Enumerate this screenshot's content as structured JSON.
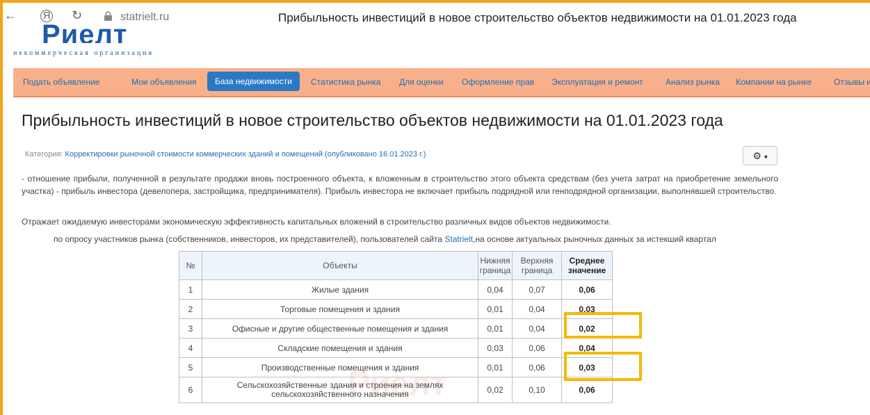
{
  "browser": {
    "url": "statrielt.ru",
    "tab_title": "Прибыльность инвестиций в новое строительство объектов недвижимости на 01.01.2023 года",
    "back_glyph": "←",
    "refresh_glyph": "↻",
    "ya_glyph": "Я"
  },
  "logo": {
    "name": "Риелт",
    "tagline": "некоммерческая организация"
  },
  "nav": {
    "items": [
      "Подать объявление",
      "Мои объявления",
      "База недвижимости",
      "Статистика рынка",
      "Для оценки",
      "Оформление прав",
      "Эксплуатация и ремонт",
      "Анализ рынка",
      "Компании на рынке",
      "Отзывы и"
    ],
    "active_index": 2
  },
  "page": {
    "title": "Прибыльность инвестиций в новое строительство объектов недвижимости на 01.01.2023 года",
    "category_label": "Категория:",
    "category_link": "Корректировки рыночной стоимости коммерческих зданий и помещений (опубликовано 16.01.2023 г.)",
    "gear_icon": "⚙",
    "gear_caret": "▾",
    "paragraph1": "- отношение прибыли, полученной в результате продажи вновь построенного объекта, к вложенным в строительство этого объекта средствам (без учета затрат на приобретение земельного участка) - прибыль инвестора (девелопера, застройщика, предпринимателя). Прибыль инвестора не включает прибыль подрядной или генподрядной организации, выполнявшей строительство.",
    "paragraph2": "Отражает ожидаемую инвесторами экономическую эффективность капитальных вложений в строительство различных видов объектов недвижимости.",
    "survey_before": "по опросу участников рынка (собственников, инвесторов, их представителей), пользователей сайта ",
    "survey_link": "Statrielt",
    "survey_after": ",на основе актуальных рыночных данных за истекший квартал"
  },
  "table": {
    "headers": [
      "№",
      "Объекты",
      "Нижняя граница",
      "Верхняя граница",
      "Среднее значение"
    ],
    "rows": [
      [
        "1",
        "Жилые здания",
        "0,04",
        "0,07",
        "0,06"
      ],
      [
        "2",
        "Торговые помещения и здания",
        "0,01",
        "0,04",
        "0,03"
      ],
      [
        "3",
        "Офисные и другие общественные помещения и здания",
        "0,01",
        "0,04",
        "0,02"
      ],
      [
        "4",
        "Складские помещения и здания",
        "0,03",
        "0,06",
        "0,04"
      ],
      [
        "5",
        "Производственные помещения и здания",
        "0,01",
        "0,06",
        "0,03"
      ],
      [
        "6",
        "Сельскохозяйственные здания и строения на землях сельскохозяйственного назначения",
        "0,02",
        "0,10",
        "0,06"
      ]
    ]
  },
  "watermark": "Риелт",
  "colors": {
    "frame": "#f5a21b",
    "nav_bg": "#f9b08a",
    "active": "#2a79c4",
    "highlight": "#f5b800",
    "link": "#1b6fb6"
  }
}
